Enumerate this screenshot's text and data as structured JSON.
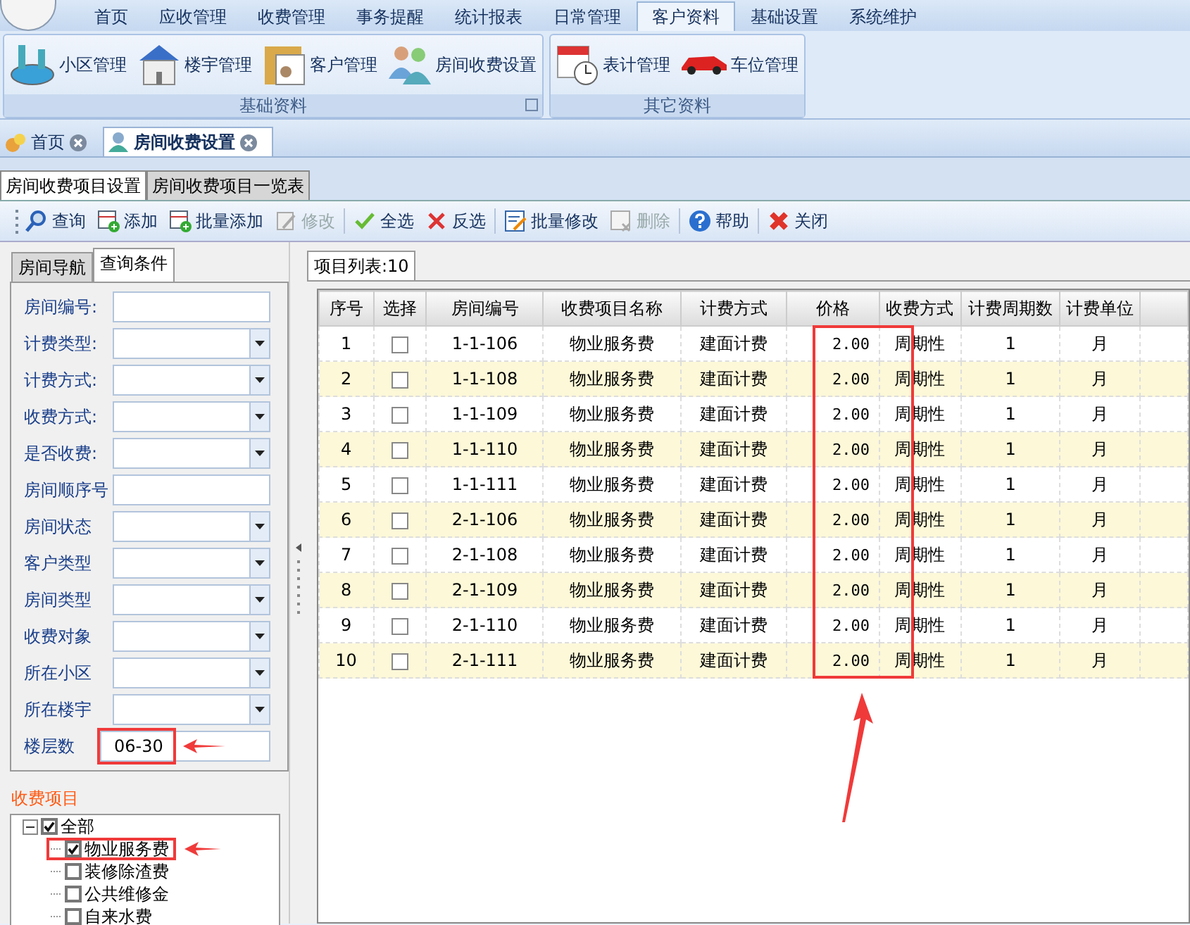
{
  "menu": [
    {
      "label": "首页",
      "selected": false
    },
    {
      "label": "应收管理",
      "selected": false
    },
    {
      "label": "收费管理",
      "selected": false
    },
    {
      "label": "事务提醒",
      "selected": false
    },
    {
      "label": "统计报表",
      "selected": false
    },
    {
      "label": "日常管理",
      "selected": false
    },
    {
      "label": "客户资料",
      "selected": true
    },
    {
      "label": "基础设置",
      "selected": false
    },
    {
      "label": "系统维护",
      "selected": false
    }
  ],
  "ribbon_groups": [
    {
      "title": "基础资料",
      "launcher": true,
      "items": [
        {
          "label": "小区管理",
          "kind": "community"
        },
        {
          "label": "楼宇管理",
          "kind": "building"
        },
        {
          "label": "客户管理",
          "kind": "customer"
        },
        {
          "label": "房间收费设置",
          "kind": "people"
        }
      ]
    },
    {
      "title": "其它资料",
      "launcher": false,
      "items": [
        {
          "label": "表计管理",
          "kind": "meter"
        },
        {
          "label": "车位管理",
          "kind": "car"
        }
      ]
    }
  ],
  "doc_tabs": [
    {
      "label": "首页",
      "selected": false
    },
    {
      "label": "房间收费设置",
      "selected": true
    }
  ],
  "sub_tabs": [
    {
      "label": "房间收费项目设置",
      "selected": true
    },
    {
      "label": "房间收费项目一览表",
      "selected": false
    }
  ],
  "toolbar": [
    {
      "label": "查询",
      "kind": "search",
      "disabled": false
    },
    {
      "label": "添加",
      "kind": "add",
      "disabled": false
    },
    {
      "label": "批量添加",
      "kind": "add",
      "disabled": false
    },
    {
      "label": "修改",
      "kind": "edit",
      "disabled": true
    },
    {
      "label": "全选",
      "kind": "check",
      "disabled": false
    },
    {
      "label": "反选",
      "kind": "cross",
      "disabled": false
    },
    {
      "label": "批量修改",
      "kind": "batch-edit",
      "disabled": false
    },
    {
      "label": "删除",
      "kind": "delete",
      "disabled": true
    },
    {
      "label": "帮助",
      "kind": "help",
      "disabled": false
    },
    {
      "label": "关闭",
      "kind": "close",
      "disabled": false
    }
  ],
  "left_tabs": [
    {
      "label": "房间导航",
      "selected": false
    },
    {
      "label": "查询条件",
      "selected": true
    }
  ],
  "filters": [
    {
      "label": "房间编号:",
      "kind": "text"
    },
    {
      "label": "计费类型:",
      "kind": "select"
    },
    {
      "label": "计费方式:",
      "kind": "select"
    },
    {
      "label": "收费方式:",
      "kind": "select"
    },
    {
      "label": "是否收费:",
      "kind": "select"
    },
    {
      "label": "房间顺序号",
      "kind": "text"
    },
    {
      "label": "房间状态",
      "kind": "select"
    },
    {
      "label": "客户类型",
      "kind": "select"
    },
    {
      "label": "房间类型",
      "kind": "select"
    },
    {
      "label": "收费对象",
      "kind": "select"
    },
    {
      "label": "所在小区",
      "kind": "select"
    },
    {
      "label": "所在楼宇",
      "kind": "select"
    },
    {
      "label": "楼层数",
      "kind": "text",
      "value": "06-30"
    }
  ],
  "fee_items": {
    "title": "收费项目",
    "tree": [
      {
        "label": "全部",
        "checked": true,
        "expanded": true,
        "children": [
          {
            "label": "物业服务费",
            "checked": true
          },
          {
            "label": "装修除渣费",
            "checked": false
          },
          {
            "label": "公共维修金",
            "checked": false
          },
          {
            "label": "自来水费",
            "checked": false
          }
        ]
      }
    ]
  },
  "grid": {
    "tab": "项目列表:10",
    "columns": [
      "序号",
      "选择",
      "房间编号",
      "收费项目名称",
      "计费方式",
      "价格",
      "收费方式",
      "计费周期数",
      "计费单位"
    ],
    "rows": [
      {
        "checked": false,
        "cells": [
          "1",
          "",
          "1-1-106",
          "物业服务费",
          "建面计费",
          "2.00",
          "周期性",
          "1",
          "月"
        ]
      },
      {
        "checked": false,
        "cells": [
          "2",
          "",
          "1-1-108",
          "物业服务费",
          "建面计费",
          "2.00",
          "周期性",
          "1",
          "月"
        ]
      },
      {
        "checked": false,
        "cells": [
          "3",
          "",
          "1-1-109",
          "物业服务费",
          "建面计费",
          "2.00",
          "周期性",
          "1",
          "月"
        ]
      },
      {
        "checked": false,
        "cells": [
          "4",
          "",
          "1-1-110",
          "物业服务费",
          "建面计费",
          "2.00",
          "周期性",
          "1",
          "月"
        ]
      },
      {
        "checked": false,
        "cells": [
          "5",
          "",
          "1-1-111",
          "物业服务费",
          "建面计费",
          "2.00",
          "周期性",
          "1",
          "月"
        ]
      },
      {
        "checked": false,
        "cells": [
          "6",
          "",
          "2-1-106",
          "物业服务费",
          "建面计费",
          "2.00",
          "周期性",
          "1",
          "月"
        ]
      },
      {
        "checked": false,
        "cells": [
          "7",
          "",
          "2-1-108",
          "物业服务费",
          "建面计费",
          "2.00",
          "周期性",
          "1",
          "月"
        ]
      },
      {
        "checked": false,
        "cells": [
          "8",
          "",
          "2-1-109",
          "物业服务费",
          "建面计费",
          "2.00",
          "周期性",
          "1",
          "月"
        ]
      },
      {
        "checked": false,
        "cells": [
          "9",
          "",
          "2-1-110",
          "物业服务费",
          "建面计费",
          "2.00",
          "周期性",
          "1",
          "月"
        ]
      },
      {
        "checked": false,
        "cells": [
          "10",
          "",
          "2-1-111",
          "物业服务费",
          "建面计费",
          "2.00",
          "周期性",
          "1",
          "月"
        ]
      }
    ]
  }
}
